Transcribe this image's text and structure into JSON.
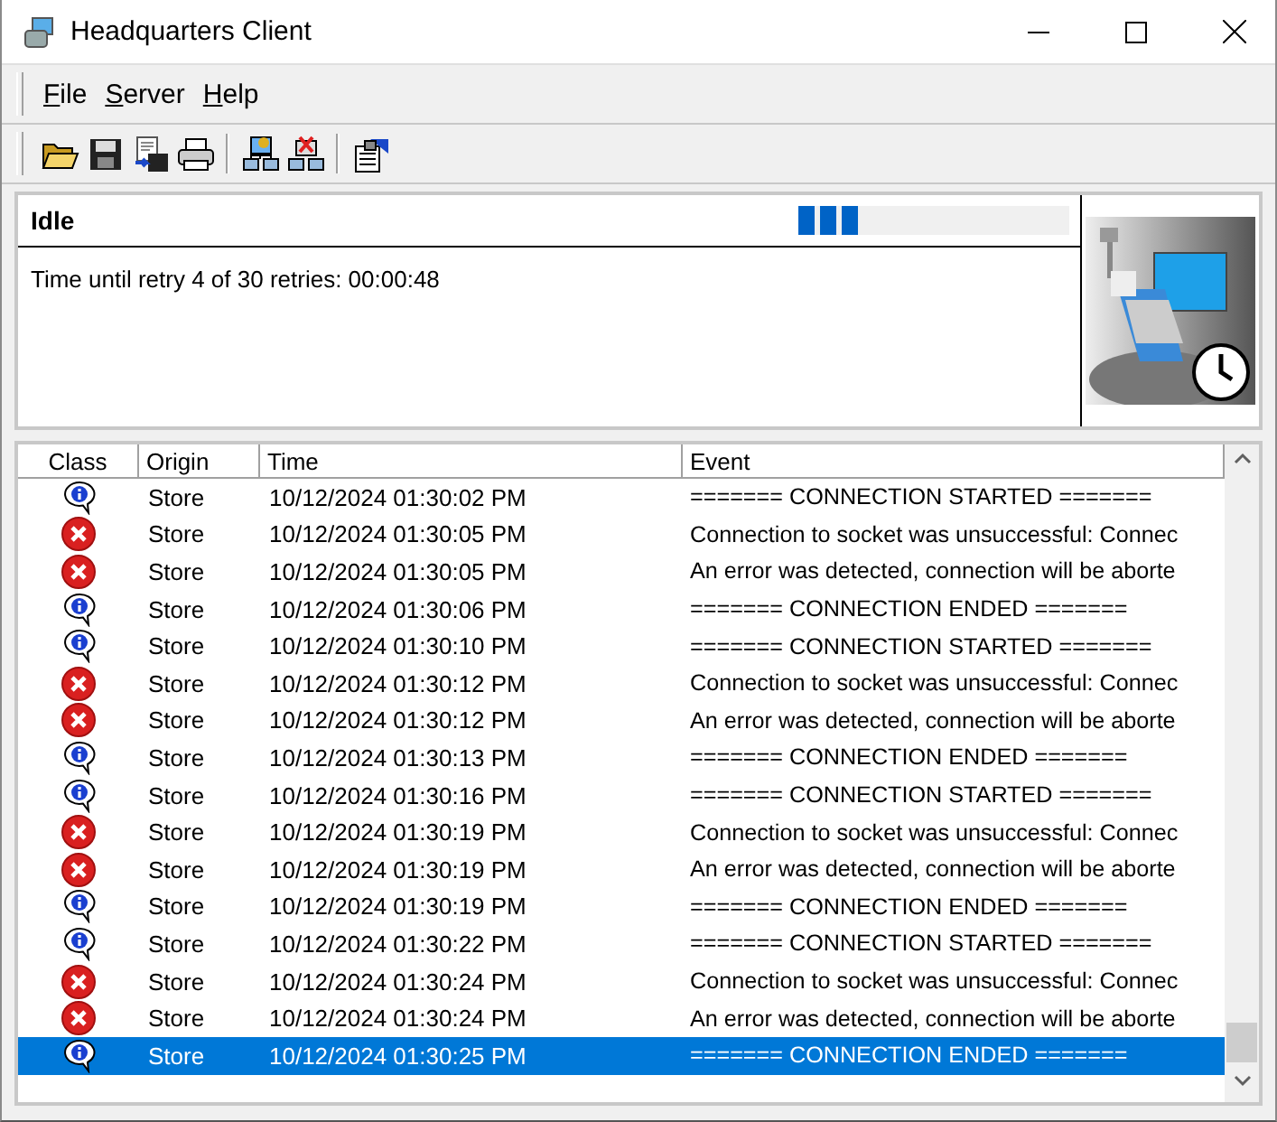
{
  "window": {
    "title": "Headquarters Client"
  },
  "menu": [
    {
      "label": "File"
    },
    {
      "label": "Server"
    },
    {
      "label": "Help"
    }
  ],
  "toolbar": [
    {
      "kind": "open"
    },
    {
      "kind": "save"
    },
    {
      "kind": "export"
    },
    {
      "kind": "print"
    },
    {
      "kind": "separator"
    },
    {
      "kind": "connect"
    },
    {
      "kind": "disconnect"
    },
    {
      "kind": "separator"
    },
    {
      "kind": "properties"
    }
  ],
  "status": {
    "state": "Idle",
    "level": 0.22,
    "message": "Time until retry 4 of 30 retries: 00:00:48"
  },
  "table": {
    "columns": [
      "Class",
      "Origin",
      "Time",
      "Event"
    ],
    "rows": [
      {
        "kind": "info",
        "origin": "Store",
        "time": "10/12/2024 01:30:02 PM",
        "event": "======= CONNECTION STARTED =======",
        "selected": false
      },
      {
        "kind": "error",
        "origin": "Store",
        "time": "10/12/2024 01:30:05 PM",
        "event": "Connection to socket was unsuccessful: Connec",
        "selected": false
      },
      {
        "kind": "error",
        "origin": "Store",
        "time": "10/12/2024 01:30:05 PM",
        "event": "An error was detected, connection will be aborte",
        "selected": false
      },
      {
        "kind": "info",
        "origin": "Store",
        "time": "10/12/2024 01:30:06 PM",
        "event": "======= CONNECTION ENDED =======",
        "selected": false
      },
      {
        "kind": "info",
        "origin": "Store",
        "time": "10/12/2024 01:30:10 PM",
        "event": "======= CONNECTION STARTED =======",
        "selected": false
      },
      {
        "kind": "error",
        "origin": "Store",
        "time": "10/12/2024 01:30:12 PM",
        "event": "Connection to socket was unsuccessful: Connec",
        "selected": false
      },
      {
        "kind": "error",
        "origin": "Store",
        "time": "10/12/2024 01:30:12 PM",
        "event": "An error was detected, connection will be aborte",
        "selected": false
      },
      {
        "kind": "info",
        "origin": "Store",
        "time": "10/12/2024 01:30:13 PM",
        "event": "======= CONNECTION ENDED =======",
        "selected": false
      },
      {
        "kind": "info",
        "origin": "Store",
        "time": "10/12/2024 01:30:16 PM",
        "event": "======= CONNECTION STARTED =======",
        "selected": false
      },
      {
        "kind": "error",
        "origin": "Store",
        "time": "10/12/2024 01:30:19 PM",
        "event": "Connection to socket was unsuccessful: Connec",
        "selected": false
      },
      {
        "kind": "error",
        "origin": "Store",
        "time": "10/12/2024 01:30:19 PM",
        "event": "An error was detected, connection will be aborte",
        "selected": false
      },
      {
        "kind": "info",
        "origin": "Store",
        "time": "10/12/2024 01:30:19 PM",
        "event": "======= CONNECTION ENDED =======",
        "selected": false
      },
      {
        "kind": "info",
        "origin": "Store",
        "time": "10/12/2024 01:30:22 PM",
        "event": "======= CONNECTION STARTED =======",
        "selected": false
      },
      {
        "kind": "error",
        "origin": "Store",
        "time": "10/12/2024 01:30:24 PM",
        "event": "Connection to socket was unsuccessful: Connec",
        "selected": false
      },
      {
        "kind": "error",
        "origin": "Store",
        "time": "10/12/2024 01:30:24 PM",
        "event": "An error was detected, connection will be aborte",
        "selected": false
      },
      {
        "kind": "info",
        "origin": "Store",
        "time": "10/12/2024 01:30:25 PM",
        "event": "======= CONNECTION ENDED =======",
        "selected": true
      }
    ]
  }
}
